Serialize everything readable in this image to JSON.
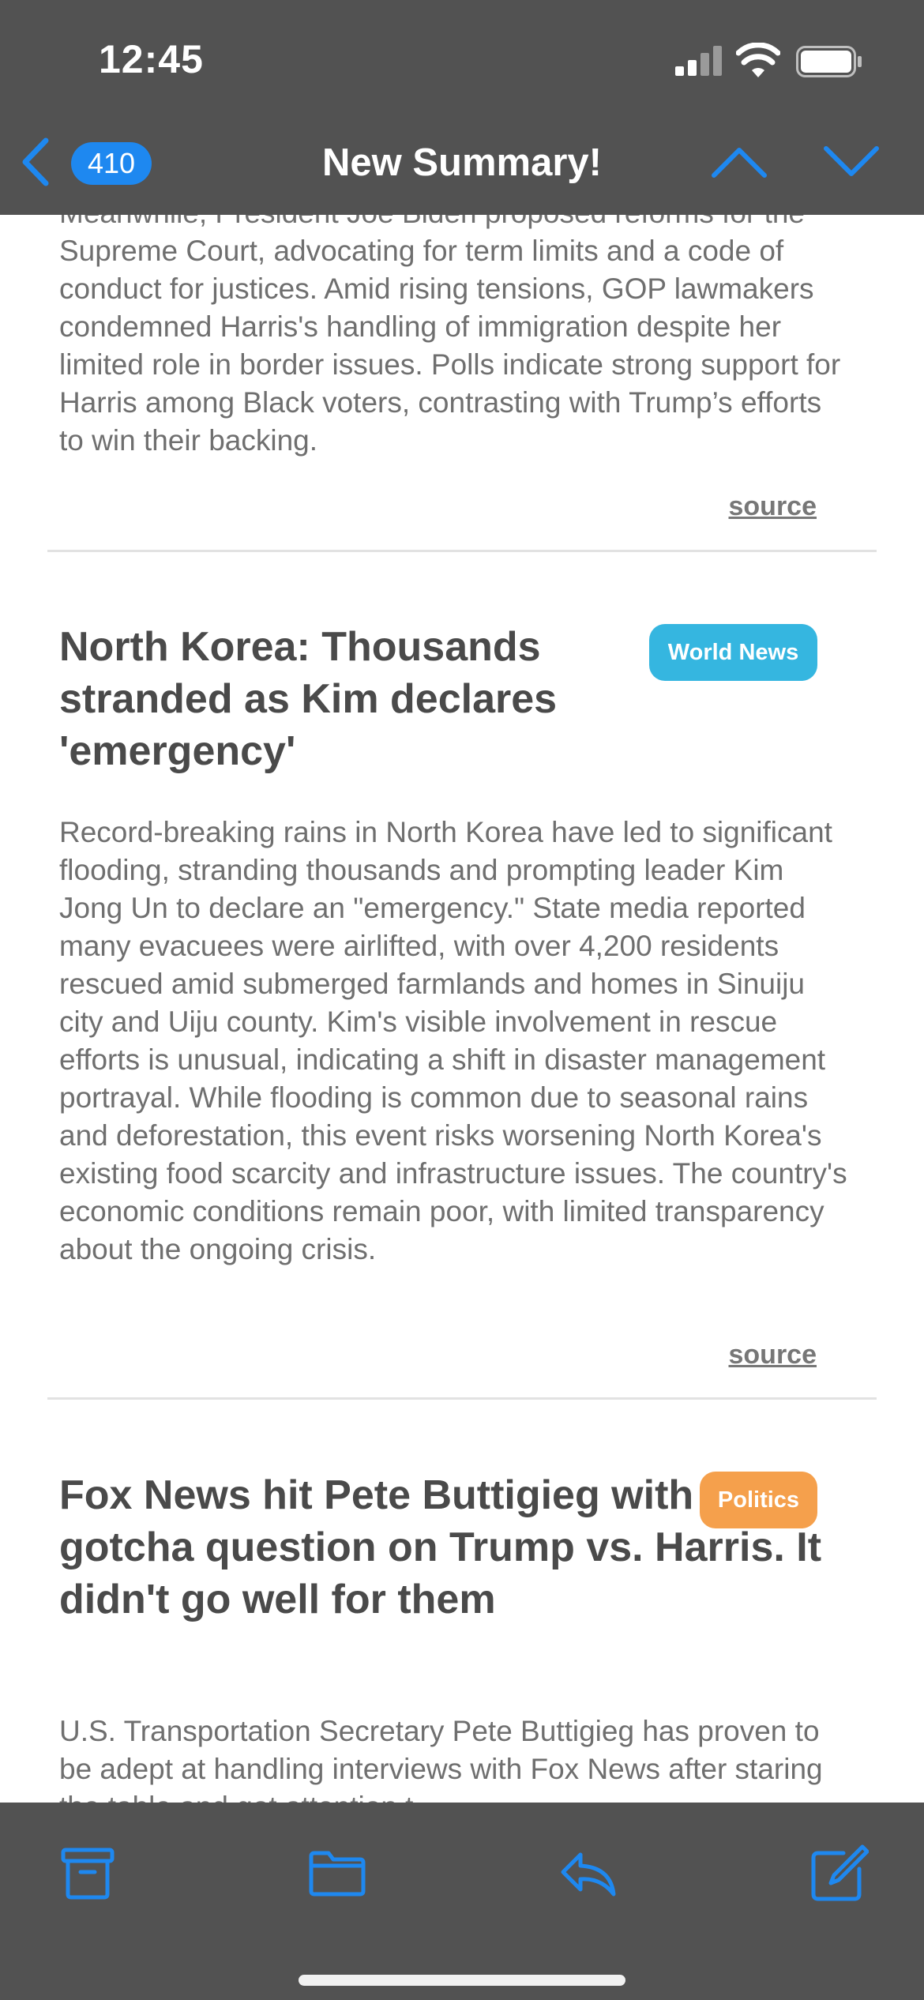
{
  "status": {
    "time": "12:45"
  },
  "nav": {
    "count": "410",
    "title": "New Summary!"
  },
  "articles": [
    {
      "body": "Meanwhile, President Joe Biden proposed reforms for the Supreme Court, advocating for term limits and a code of conduct for justices. Amid rising tensions, GOP lawmakers condemned Harris's handling of immigration despite her limited role in border issues. Polls indicate strong support for Harris among Black voters, contrasting with Trump’s efforts to win their backing.",
      "source_label": "source"
    },
    {
      "headline": "North Korea: Thousands stranded as Kim declares 'emergency'",
      "tag": "World News",
      "body": "Record-breaking rains in North Korea have led to significant flooding, stranding thousands and prompting leader Kim Jong Un to declare an \"emergency.\" State media reported many evacuees were airlifted, with over 4,200 residents rescued amid submerged farmlands and homes in Sinuiju city and Uiju county. Kim's visible involvement in rescue efforts is unusual, indicating a shift in disaster management portrayal. While flooding is common due to seasonal rains and deforestation, this event risks worsening North Korea's existing food scarcity and infrastructure issues. The country's economic conditions remain poor, with limited transparency about the ongoing crisis.",
      "source_label": "source"
    },
    {
      "headline": "Fox News hit Pete Buttigieg with a gotcha question on Trump vs. Harris. It didn't go well for them",
      "tag": "Politics",
      "body": "U.S. Transportation Secretary Pete Buttigieg has proven to be adept at handling interviews with Fox News after staring the table and got attention t"
    }
  ],
  "colors": {
    "bar_background": "#525252",
    "accent_blue": "#1e88f0",
    "tag_world_news": "#35b6e0",
    "tag_politics": "#f5a04c"
  },
  "icons": {
    "status": [
      "cellular-signal-icon",
      "wifi-icon",
      "battery-icon"
    ],
    "nav": [
      "back-chevron-icon",
      "previous-message-icon",
      "next-message-icon"
    ],
    "toolbar": [
      "archive-icon",
      "folder-icon",
      "reply-icon",
      "compose-icon"
    ]
  }
}
